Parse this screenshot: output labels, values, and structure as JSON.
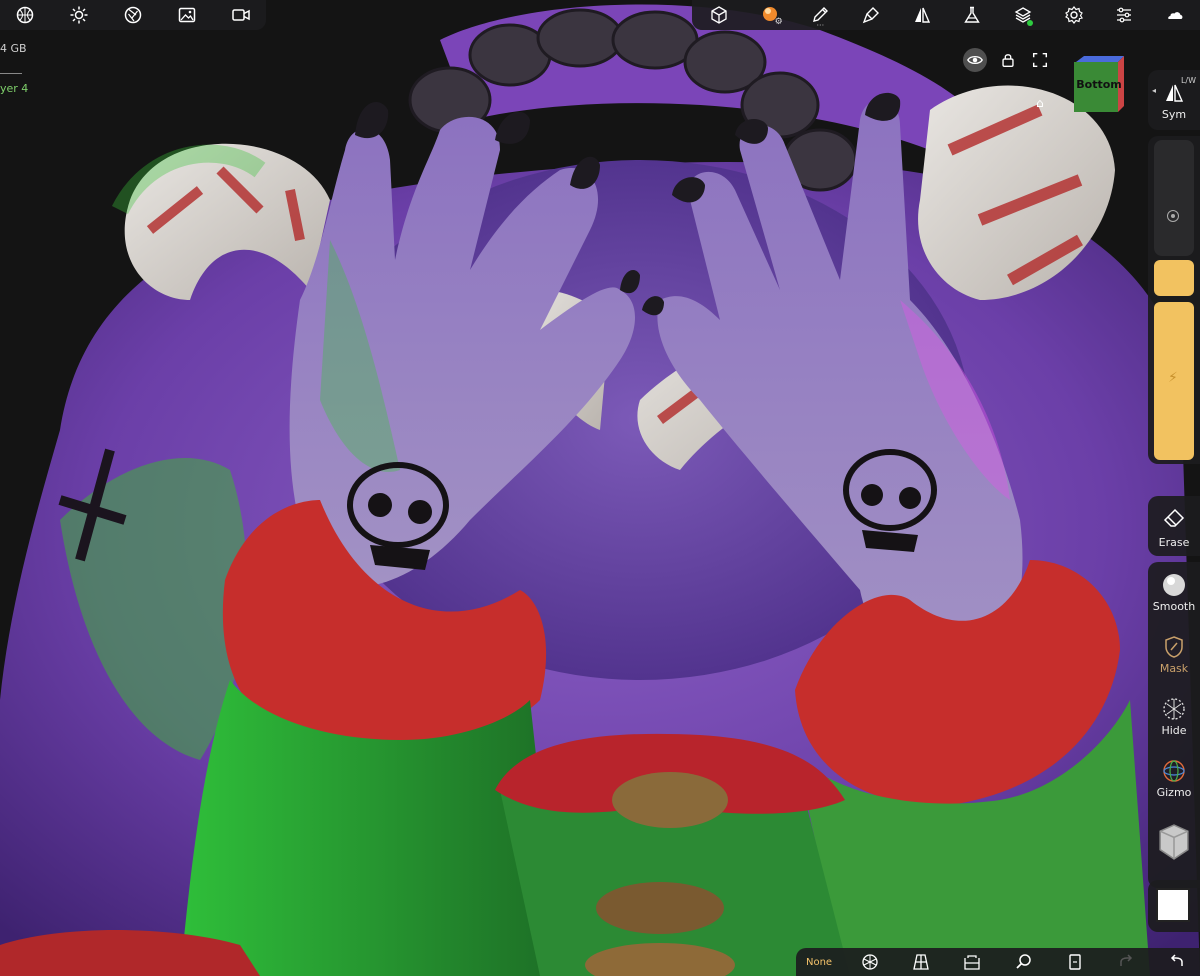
{
  "memory": {
    "text": "4 GB"
  },
  "layer": {
    "label": "yer 4"
  },
  "top_left_toolbar": {
    "icons": [
      "sphere-grid-icon",
      "sun-icon",
      "aperture-icon",
      "image-icon",
      "video-camera-icon"
    ]
  },
  "top_right_toolbar": {
    "icons": [
      "scene-cube-icon",
      "material-ball-icon",
      "pen-icon",
      "brush-icon",
      "symmetry-icon",
      "flask-icon",
      "layers-icon",
      "gear-icon",
      "sliders-icon",
      "cloud-icon"
    ]
  },
  "view_controls": {
    "icons": [
      "eye-icon",
      "lock-icon",
      "fullscreen-icon"
    ]
  },
  "nav_cube": {
    "label": "Bottom",
    "colors": {
      "front": "#3a8a36",
      "left": "#c44",
      "top": "#4a6bdc"
    }
  },
  "right_panel": {
    "sym": {
      "hint": "L/W",
      "label": "Sym"
    },
    "erase": {
      "label": "Erase"
    },
    "smooth": {
      "label": "Smooth"
    },
    "mask": {
      "label": "Mask"
    },
    "hide": {
      "label": "Hide"
    },
    "gizmo": {
      "label": "Gizmo"
    },
    "slider_color": "#f2c260"
  },
  "bottom_toolbar": {
    "selection_label": "None",
    "icons": [
      "wireframe-sphere-icon",
      "perspective-grid-icon",
      "bucket-icon",
      "search-icon",
      "document-icon",
      "redo-icon",
      "undo-icon"
    ]
  },
  "colors": {
    "accent": "#f2c260",
    "layer_green": "#7fd06b",
    "panel": "#1c1c1e"
  }
}
